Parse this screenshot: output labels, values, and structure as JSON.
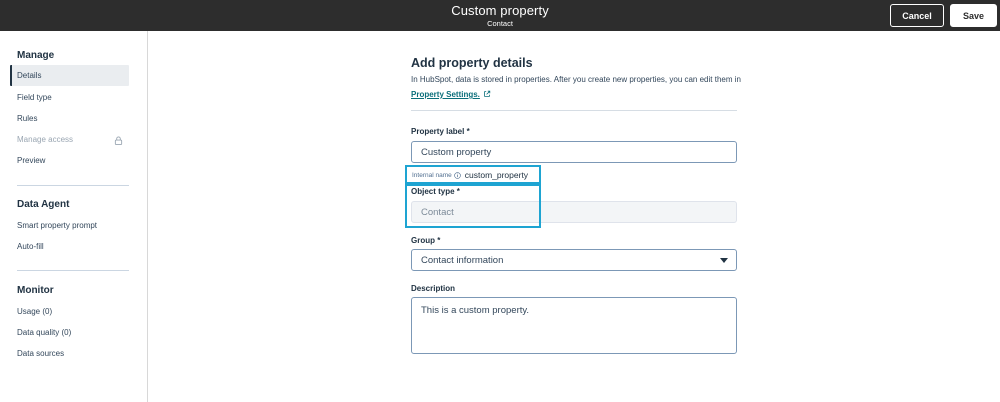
{
  "header": {
    "title": "Custom property",
    "subtitle": "Contact",
    "cancel_label": "Cancel",
    "save_label": "Save"
  },
  "sidebar": {
    "sections": [
      {
        "title": "Manage",
        "items": [
          {
            "label": "Details",
            "active": true
          },
          {
            "label": "Field type"
          },
          {
            "label": "Rules"
          },
          {
            "label": "Manage access",
            "disabled": true,
            "icon": "lock-icon"
          },
          {
            "label": "Preview"
          }
        ]
      },
      {
        "title": "Data Agent",
        "items": [
          {
            "label": "Smart property prompt"
          },
          {
            "label": "Auto-fill"
          }
        ]
      },
      {
        "title": "Monitor",
        "items": [
          {
            "label": "Usage (0)"
          },
          {
            "label": "Data quality (0)"
          },
          {
            "label": "Data sources"
          }
        ]
      }
    ]
  },
  "main": {
    "heading": "Add property details",
    "intro_text": "In HubSpot, data is stored in properties. After you create new properties, you can edit them in",
    "intro_link": "Property Settings.",
    "property_label": {
      "label": "Property label *",
      "value": "Custom property"
    },
    "internal_name": {
      "label": "Internal name",
      "value": "custom_property"
    },
    "object_type": {
      "label": "Object type *",
      "value": "Contact"
    },
    "group": {
      "label": "Group *",
      "value": "Contact information"
    },
    "description": {
      "label": "Description",
      "value": "This is a custom property."
    }
  },
  "colors": {
    "header_bg": "#2d2d2d",
    "link": "#0a6e7a",
    "highlight": "#1ea4d2"
  }
}
